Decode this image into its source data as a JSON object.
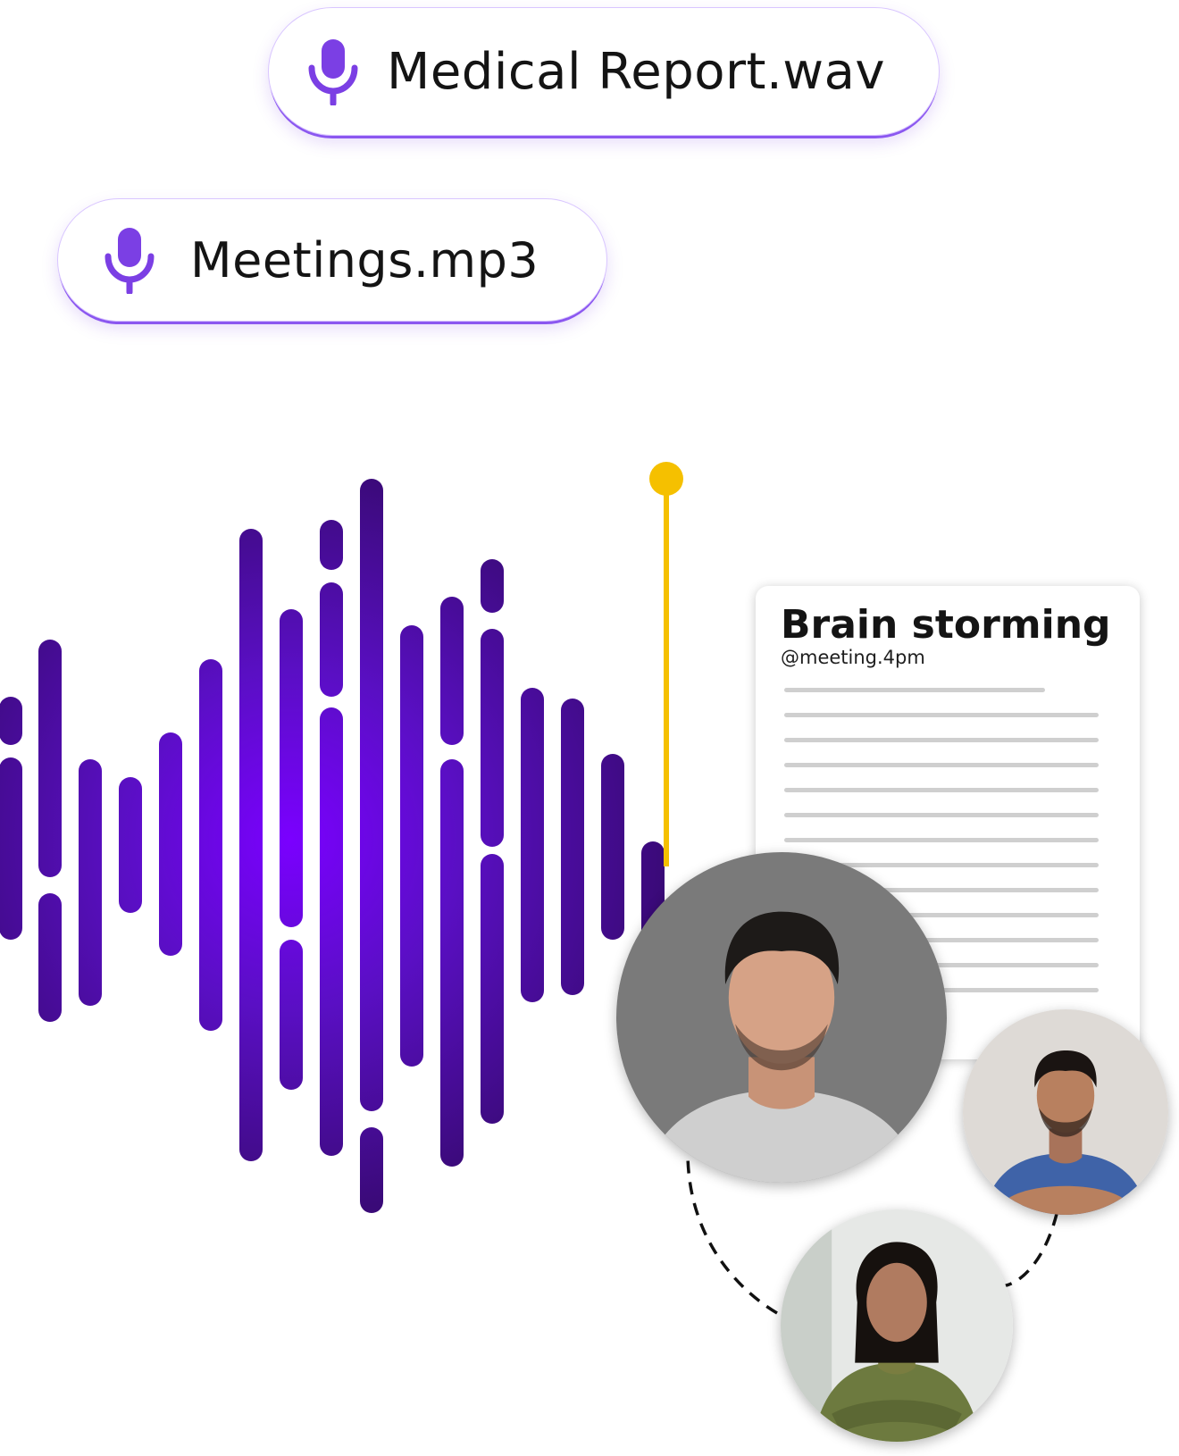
{
  "files": [
    {
      "name": "Medical Report.wav",
      "icon": "microphone-icon"
    },
    {
      "name": "Meetings.mp3",
      "icon": "microphone-icon"
    }
  ],
  "note": {
    "title": "Brain storming",
    "handle": "@meeting.4pm",
    "line_count": 13
  },
  "participants": [
    {
      "label": "participant-avatar-man-grey-shirt"
    },
    {
      "label": "participant-avatar-man-blue-shirt"
    },
    {
      "label": "participant-avatar-woman-green-sweater"
    }
  ],
  "colors": {
    "accent": "#7b3fe4",
    "wave_dark": "#3d0a7a",
    "wave_glow": "#7a00ff",
    "playhead": "#f5c000",
    "text": "#141414"
  },
  "playhead": {
    "icon": "playhead-marker"
  }
}
